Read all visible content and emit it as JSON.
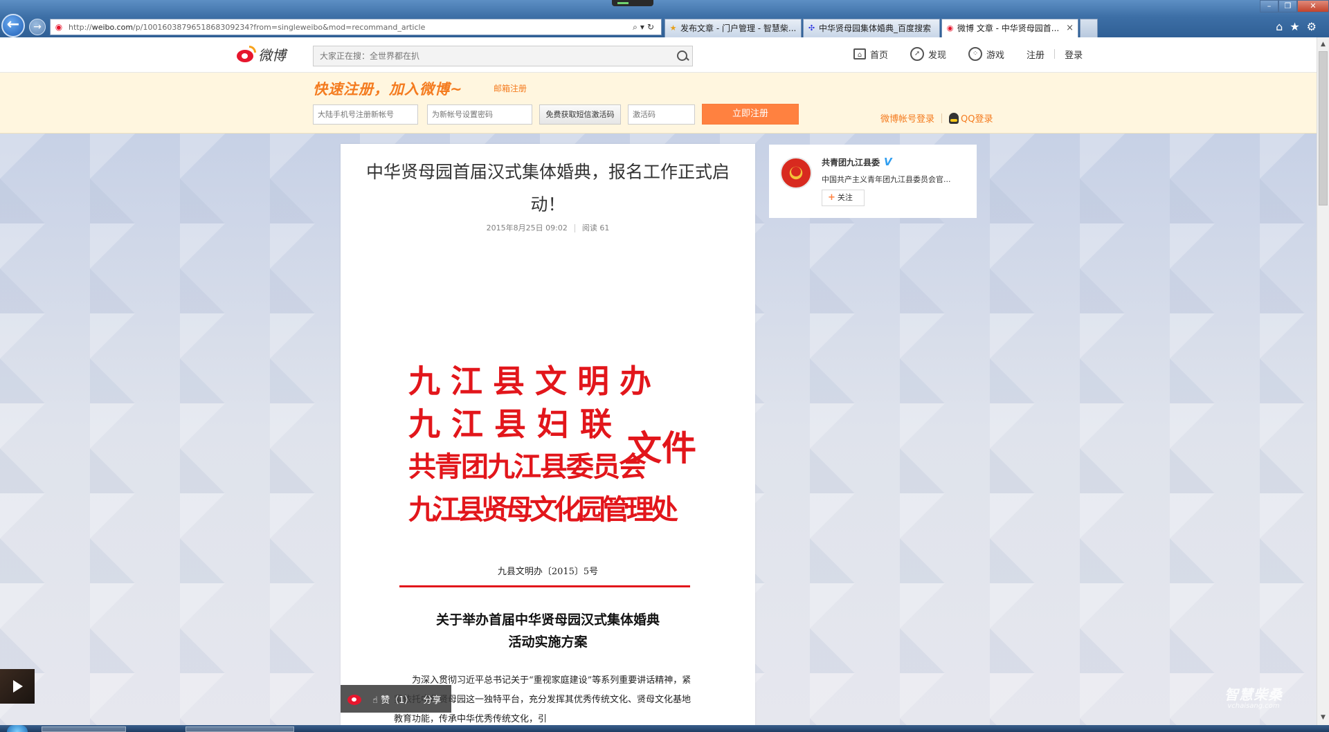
{
  "browser": {
    "url_prefix": "http://",
    "url_domain": "weibo.com",
    "url_path": "/p/1001603879651868309234?from=singleweibo&mod=recommand_article",
    "tabs": [
      {
        "label": "发布文章 - 门户管理 - 智慧柴...",
        "icon": "portal-icon"
      },
      {
        "label": "中华贤母园集体婚典_百度搜索",
        "icon": "baidu-paw-icon"
      },
      {
        "label": "微博 文章 - 中华贤母园首...",
        "icon": "weibo-icon",
        "active": true
      }
    ]
  },
  "weibo_nav": {
    "logo_text": "微博",
    "search_placeholder": "大家正在搜：全世界都在扒",
    "items": [
      {
        "label": "首页",
        "icon": "home-icon"
      },
      {
        "label": "发现",
        "icon": "compass-icon"
      },
      {
        "label": "游戏",
        "icon": "gamepad-icon"
      }
    ],
    "register": "注册",
    "login": "登录"
  },
  "register_banner": {
    "slogan": "快速注册，加入微博~",
    "email_register": "邮箱注册",
    "phone_placeholder": "大陆手机号注册新帐号",
    "password_placeholder": "为新帐号设置密码",
    "sms_button": "免费获取短信激活码",
    "code_placeholder": "激活码",
    "submit_button": "立即注册",
    "weibo_login": "微博帐号登录",
    "qq_login": "QQ登录"
  },
  "article": {
    "title": "中华贤母园首届汉式集体婚典，报名工作正式启动！",
    "date": "2015年8月25日 09:02",
    "reads": "阅读 61",
    "doc_header_lines": [
      "九江县文明办",
      "九 江 县 妇 联",
      "共青团九江县委员会",
      "九江县贤母文化园管理处"
    ],
    "doc_suffix": "文件",
    "doc_number": "九县文明办〔2015〕5号",
    "doc_title_line1": "关于举办首届中华贤母园汉式集体婚典",
    "doc_title_line2": "活动实施方案",
    "doc_body": "为深入贯彻习近平总书记关于“重视家庭建设”等系列重要讲话精神，紧紧依托中华贤母园这一独特平台，充分发挥其优秀传统文化、贤母文化基地教育功能，传承中华优秀传统文化，引"
  },
  "author": {
    "name": "共青团九江县委",
    "desc": "中国共产主义青年团九江县委员会官...",
    "follow": "关注",
    "follow_plus": "+"
  },
  "float_bar": {
    "like": "赞（1）",
    "share": "分享"
  },
  "watermark": {
    "text": "智慧柴桑",
    "sub": "vchaisang.com"
  },
  "colors": {
    "weibo_red": "#e6162d",
    "accent_orange": "#ff8140",
    "doc_red": "#e2161b",
    "banner_bg": "#fff6df"
  }
}
